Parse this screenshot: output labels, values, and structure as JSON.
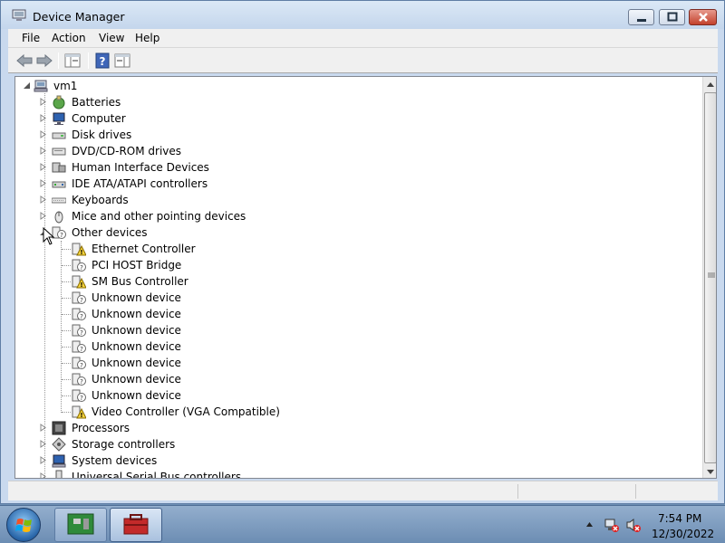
{
  "window": {
    "title": "Device Manager"
  },
  "menu": {
    "items": [
      "File",
      "Action",
      "View",
      "Help"
    ]
  },
  "tree": {
    "root": "vm1",
    "items": [
      {
        "label": "Batteries",
        "icon": "battery-icon",
        "expanded": false
      },
      {
        "label": "Computer",
        "icon": "computer-icon",
        "expanded": false
      },
      {
        "label": "Disk drives",
        "icon": "disk-drive-icon",
        "expanded": false
      },
      {
        "label": "DVD/CD-ROM drives",
        "icon": "dvd-drive-icon",
        "expanded": false
      },
      {
        "label": "Human Interface Devices",
        "icon": "hid-icon",
        "expanded": false
      },
      {
        "label": "IDE ATA/ATAPI controllers",
        "icon": "ide-controller-icon",
        "expanded": false
      },
      {
        "label": "Keyboards",
        "icon": "keyboard-icon",
        "expanded": false
      },
      {
        "label": "Mice and other pointing devices",
        "icon": "mouse-icon",
        "expanded": false
      },
      {
        "label": "Other devices",
        "icon": "unknown-device-icon",
        "expanded": true
      }
    ],
    "other_devices": [
      "Ethernet Controller",
      "PCI HOST Bridge",
      "SM Bus Controller",
      "Unknown device",
      "Unknown device",
      "Unknown device",
      "Unknown device",
      "Unknown device",
      "Unknown device",
      "Unknown device",
      "Video Controller (VGA Compatible)"
    ],
    "items_after": [
      {
        "label": "Processors",
        "icon": "processor-icon"
      },
      {
        "label": "Storage controllers",
        "icon": "storage-controller-icon"
      },
      {
        "label": "System devices",
        "icon": "system-devices-icon"
      },
      {
        "label": "Universal Serial Bus controllers",
        "icon": "usb-icon"
      }
    ]
  },
  "taskbar": {
    "time": "7:54 PM",
    "date": "12/30/2022"
  }
}
